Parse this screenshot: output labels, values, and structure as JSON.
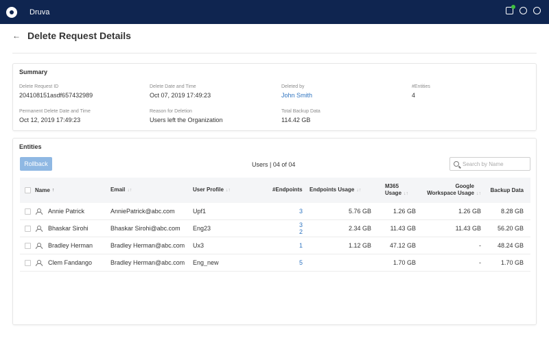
{
  "app": {
    "brand": "Druva"
  },
  "page": {
    "title": "Delete Request Details"
  },
  "summary": {
    "title": "Summary",
    "fields": {
      "request_id": {
        "label": "Delete Request ID",
        "value": "204108151asdf657432989"
      },
      "delete_datetime": {
        "label": "Delete Date and Time",
        "value": "Oct 07, 2019 17:49:23"
      },
      "deleted_by": {
        "label": "Deleted by",
        "value": "John Smith"
      },
      "entities_count": {
        "label": "#Entities",
        "value": "4"
      },
      "permanent_delete": {
        "label": "Permanent Delete Date and Time",
        "value": "Oct 12, 2019 17:49:23"
      },
      "reason": {
        "label": "Reason for Deletion",
        "value": "Users left the Organization"
      },
      "total_backup": {
        "label": "Total Backup Data",
        "value": "114.42 GB"
      }
    }
  },
  "entities": {
    "title": "Entities",
    "rollback_label": "Rollback",
    "users_count": "Users | 04 of 04",
    "search_placeholder": "Search by Name",
    "columns": {
      "name": "Name",
      "email": "Email",
      "profile": "User Profile",
      "endpoints": "#Endpoints",
      "endpoints_usage": "Endpoints Usage",
      "m365_line1": "M365",
      "m365_line2": "Usage",
      "gws_line1": "Google",
      "gws_line2": "Workspace Usage",
      "backup": "Backup Data"
    },
    "rows": [
      {
        "name": "Annie Patrick",
        "email": "AnniePatrick@abc.com",
        "profile": "Upf1",
        "endpoints": [
          "3"
        ],
        "endpoints_usage": "5.76 GB",
        "m365": "1.26 GB",
        "gws": "1.26 GB",
        "backup": "8.28 GB"
      },
      {
        "name": "Bhaskar Sirohi",
        "email": "Bhaskar Sirohi@abc.com",
        "profile": "Eng23",
        "endpoints": [
          "3",
          "2"
        ],
        "endpoints_usage": "2.34 GB",
        "m365": "11.43 GB",
        "gws": "11.43 GB",
        "backup": "56.20 GB"
      },
      {
        "name": "Bradley Herman",
        "email": "Bradley Herman@abc.com",
        "profile": "Ux3",
        "endpoints": [
          "1"
        ],
        "endpoints_usage": "1.12 GB",
        "m365": "47.12 GB",
        "gws": "-",
        "backup": "48.24 GB"
      },
      {
        "name": "Clem Fandango",
        "email": "Bradley Herman@abc.com",
        "profile": "Eng_new",
        "endpoints": [
          "5"
        ],
        "endpoints_usage": "",
        "m365": "1.70 GB",
        "gws": "-",
        "backup": "1.70 GB"
      }
    ]
  },
  "colors": {
    "topbar": "#0f2550",
    "link": "#2f74c0",
    "rollback": "#8fb8e3",
    "notification": "#3fc13f"
  }
}
